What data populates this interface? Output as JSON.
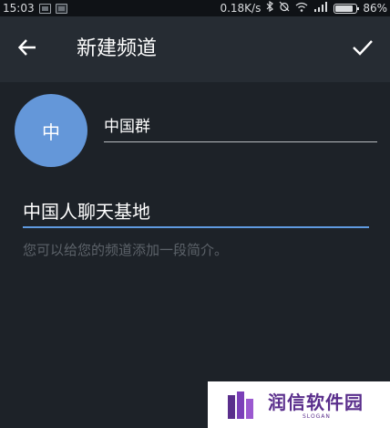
{
  "status_bar": {
    "time": "15:03",
    "network_speed": "0.18K/s",
    "battery_percent": "86%",
    "icons": [
      "bluetooth-icon",
      "alarm-off-icon",
      "wifi-icon",
      "signal-icon",
      "battery-icon"
    ]
  },
  "toolbar": {
    "title": "新建频道",
    "back_icon": "arrow-left-icon",
    "confirm_icon": "checkmark-icon"
  },
  "channel": {
    "avatar_letter": "中",
    "name": "中国群",
    "description": "中国人聊天基地",
    "description_hint": "您可以给您的频道添加一段简介。"
  },
  "watermark": {
    "text": "润信软件园",
    "slogan": "SLOGAN"
  },
  "colors": {
    "background": "#1d2228",
    "toolbar": "#262c33",
    "avatar": "#6497d9",
    "accent": "#5f9ae0",
    "hint_text": "#5c6269"
  }
}
